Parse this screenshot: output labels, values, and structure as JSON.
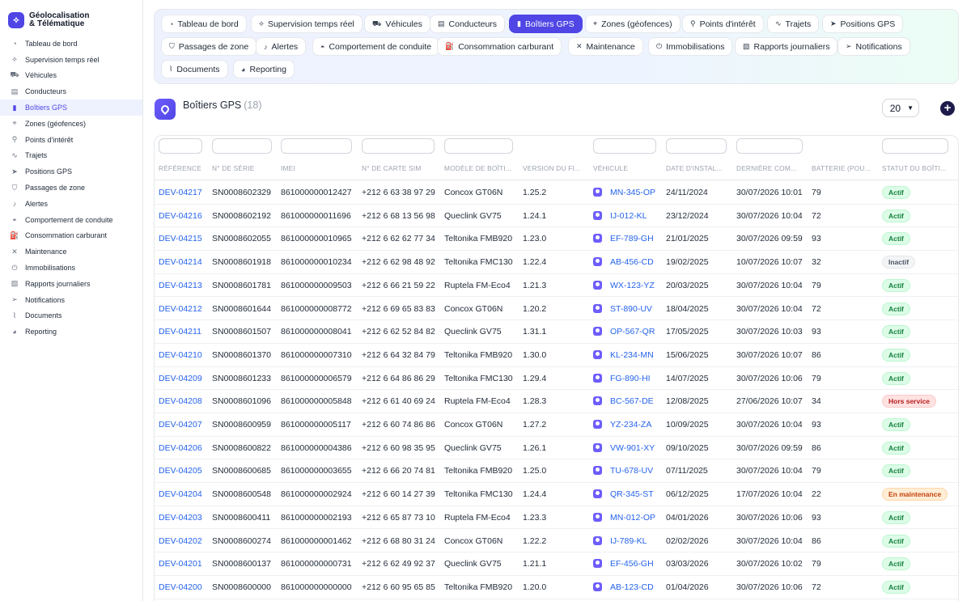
{
  "app": {
    "title_line1": "Géolocalisation",
    "title_line2": "& Télématique"
  },
  "sidebar": {
    "items": [
      {
        "label": "Tableau de bord",
        "icon": "dashboard-icon",
        "glyph": "◔"
      },
      {
        "label": "Supervision temps réel",
        "icon": "satellite-icon",
        "glyph": "⟡"
      },
      {
        "label": "Véhicules",
        "icon": "car-icon",
        "glyph": "⛟"
      },
      {
        "label": "Conducteurs",
        "icon": "id-card-icon",
        "glyph": "▤"
      },
      {
        "label": "Boîtiers GPS",
        "icon": "device-icon",
        "glyph": "▮"
      },
      {
        "label": "Zones (géofences)",
        "icon": "map-icon",
        "glyph": "⌖"
      },
      {
        "label": "Points d'intérêt",
        "icon": "map-pin-icon",
        "glyph": "⚲"
      },
      {
        "label": "Trajets",
        "icon": "route-icon",
        "glyph": "∿"
      },
      {
        "label": "Positions GPS",
        "icon": "navigation-icon",
        "glyph": "➤"
      },
      {
        "label": "Passages de zone",
        "icon": "shield-icon",
        "glyph": "⛉"
      },
      {
        "label": "Alertes",
        "icon": "bell-icon",
        "glyph": "♪"
      },
      {
        "label": "Comportement de conduite",
        "icon": "gauge-icon",
        "glyph": "◓"
      },
      {
        "label": "Consommation carburant",
        "icon": "fuel-icon",
        "glyph": "⛽"
      },
      {
        "label": "Maintenance",
        "icon": "wrench-icon",
        "glyph": "✕"
      },
      {
        "label": "Immobilisations",
        "icon": "power-icon",
        "glyph": "⏻"
      },
      {
        "label": "Rapports journaliers",
        "icon": "file-icon",
        "glyph": "▧"
      },
      {
        "label": "Notifications",
        "icon": "send-icon",
        "glyph": "➢"
      },
      {
        "label": "Documents",
        "icon": "paperclip-icon",
        "glyph": "⌇"
      },
      {
        "label": "Reporting",
        "icon": "pie-chart-icon",
        "glyph": "◕"
      }
    ],
    "active_index": 4
  },
  "tabs": {
    "items": [
      {
        "label": "Tableau de bord",
        "glyph": "◔"
      },
      {
        "label": "Supervision temps réel",
        "glyph": "⟡"
      },
      {
        "label": "Véhicules",
        "glyph": "⛟"
      },
      {
        "label": "Conducteurs",
        "glyph": "▤"
      },
      {
        "label": "Boîtiers GPS",
        "glyph": "▮"
      },
      {
        "label": "Zones (géofences)",
        "glyph": "⌖"
      },
      {
        "label": "Points d'intérêt",
        "glyph": "⚲"
      },
      {
        "label": "Trajets",
        "glyph": "∿"
      },
      {
        "label": "Positions GPS",
        "glyph": "➤"
      },
      {
        "label": "Passages de zone",
        "glyph": "⛉"
      },
      {
        "label": "Alertes",
        "glyph": "♪"
      },
      {
        "label": "Comportement de conduite",
        "glyph": "◓"
      },
      {
        "label": "Consommation carburant",
        "glyph": "⛽"
      },
      {
        "label": "Maintenance",
        "glyph": "✕"
      },
      {
        "label": "Immobilisations",
        "glyph": "⏻"
      },
      {
        "label": "Rapports journaliers",
        "glyph": "▧"
      },
      {
        "label": "Notifications",
        "glyph": "➢"
      },
      {
        "label": "Documents",
        "glyph": "⌇"
      },
      {
        "label": "Reporting",
        "glyph": "◕"
      }
    ],
    "active_index": 4
  },
  "header": {
    "title": "Boîtiers GPS",
    "count": "(18)",
    "per_page": "20",
    "add_label": "+"
  },
  "table": {
    "columns": [
      "RÉFÉRENCE",
      "N° DE SÉRIE",
      "IMEI",
      "N° DE CARTE SIM",
      "MODÈLE DE BOÎTI...",
      "VERSION DU FI...",
      "VÉHICULE",
      "DATE D'INSTAL...",
      "DERNIÈRE COM...",
      "BATTERIE (POU...",
      "STATUT DU BOÎTI..."
    ],
    "rows": [
      {
        "ref": "DEV-04217",
        "serial": "SN0008602329",
        "imei": "861000000012427",
        "sim": "+212 6 63 38 97 29",
        "model": "Concox GT06N",
        "fw": "1.25.2",
        "vehicle": "MN-345-OP",
        "install": "24/11/2024",
        "last": "30/07/2026 10:01",
        "battery": "79",
        "status": "Actif",
        "status_kind": "actif"
      },
      {
        "ref": "DEV-04216",
        "serial": "SN0008602192",
        "imei": "861000000011696",
        "sim": "+212 6 68 13 56 98",
        "model": "Queclink GV75",
        "fw": "1.24.1",
        "vehicle": "IJ-012-KL",
        "install": "23/12/2024",
        "last": "30/07/2026 10:04",
        "battery": "72",
        "status": "Actif",
        "status_kind": "actif"
      },
      {
        "ref": "DEV-04215",
        "serial": "SN0008602055",
        "imei": "861000000010965",
        "sim": "+212 6 62 62 77 34",
        "model": "Teltonika FMB920",
        "fw": "1.23.0",
        "vehicle": "EF-789-GH",
        "install": "21/01/2025",
        "last": "30/07/2026 09:59",
        "battery": "93",
        "status": "Actif",
        "status_kind": "actif"
      },
      {
        "ref": "DEV-04214",
        "serial": "SN0008601918",
        "imei": "861000000010234",
        "sim": "+212 6 62 98 48 92",
        "model": "Teltonika FMC130",
        "fw": "1.22.4",
        "vehicle": "AB-456-CD",
        "install": "19/02/2025",
        "last": "10/07/2026 10:07",
        "battery": "32",
        "status": "Inactif",
        "status_kind": "inactif"
      },
      {
        "ref": "DEV-04213",
        "serial": "SN0008601781",
        "imei": "861000000009503",
        "sim": "+212 6 66 21 59 22",
        "model": "Ruptela FM-Eco4",
        "fw": "1.21.3",
        "vehicle": "WX-123-YZ",
        "install": "20/03/2025",
        "last": "30/07/2026 10:04",
        "battery": "79",
        "status": "Actif",
        "status_kind": "actif"
      },
      {
        "ref": "DEV-04212",
        "serial": "SN0008601644",
        "imei": "861000000008772",
        "sim": "+212 6 69 65 83 83",
        "model": "Concox GT06N",
        "fw": "1.20.2",
        "vehicle": "ST-890-UV",
        "install": "18/04/2025",
        "last": "30/07/2026 10:04",
        "battery": "72",
        "status": "Actif",
        "status_kind": "actif"
      },
      {
        "ref": "DEV-04211",
        "serial": "SN0008601507",
        "imei": "861000000008041",
        "sim": "+212 6 62 52 84 82",
        "model": "Queclink GV75",
        "fw": "1.31.1",
        "vehicle": "OP-567-QR",
        "install": "17/05/2025",
        "last": "30/07/2026 10:03",
        "battery": "93",
        "status": "Actif",
        "status_kind": "actif"
      },
      {
        "ref": "DEV-04210",
        "serial": "SN0008601370",
        "imei": "861000000007310",
        "sim": "+212 6 64 32 84 79",
        "model": "Teltonika FMB920",
        "fw": "1.30.0",
        "vehicle": "KL-234-MN",
        "install": "15/06/2025",
        "last": "30/07/2026 10:07",
        "battery": "86",
        "status": "Actif",
        "status_kind": "actif"
      },
      {
        "ref": "DEV-04209",
        "serial": "SN0008601233",
        "imei": "861000000006579",
        "sim": "+212 6 64 86 86 29",
        "model": "Teltonika FMC130",
        "fw": "1.29.4",
        "vehicle": "FG-890-HI",
        "install": "14/07/2025",
        "last": "30/07/2026 10:06",
        "battery": "79",
        "status": "Actif",
        "status_kind": "actif"
      },
      {
        "ref": "DEV-04208",
        "serial": "SN0008601096",
        "imei": "861000000005848",
        "sim": "+212 6 61 40 69 24",
        "model": "Ruptela FM-Eco4",
        "fw": "1.28.3",
        "vehicle": "BC-567-DE",
        "install": "12/08/2025",
        "last": "27/06/2026 10:07",
        "battery": "34",
        "status": "Hors service",
        "status_kind": "hors"
      },
      {
        "ref": "DEV-04207",
        "serial": "SN0008600959",
        "imei": "861000000005117",
        "sim": "+212 6 60 74 86 86",
        "model": "Concox GT06N",
        "fw": "1.27.2",
        "vehicle": "YZ-234-ZA",
        "install": "10/09/2025",
        "last": "30/07/2026 10:04",
        "battery": "93",
        "status": "Actif",
        "status_kind": "actif"
      },
      {
        "ref": "DEV-04206",
        "serial": "SN0008600822",
        "imei": "861000000004386",
        "sim": "+212 6 60 98 35 95",
        "model": "Queclink GV75",
        "fw": "1.26.1",
        "vehicle": "VW-901-XY",
        "install": "09/10/2025",
        "last": "30/07/2026 09:59",
        "battery": "86",
        "status": "Actif",
        "status_kind": "actif"
      },
      {
        "ref": "DEV-04205",
        "serial": "SN0008600685",
        "imei": "861000000003655",
        "sim": "+212 6 66 20 74 81",
        "model": "Teltonika FMB920",
        "fw": "1.25.0",
        "vehicle": "TU-678-UV",
        "install": "07/11/2025",
        "last": "30/07/2026 10:04",
        "battery": "79",
        "status": "Actif",
        "status_kind": "actif"
      },
      {
        "ref": "DEV-04204",
        "serial": "SN0008600548",
        "imei": "861000000002924",
        "sim": "+212 6 60 14 27 39",
        "model": "Teltonika FMC130",
        "fw": "1.24.4",
        "vehicle": "QR-345-ST",
        "install": "06/12/2025",
        "last": "17/07/2026 10:04",
        "battery": "22",
        "status": "En maintenance",
        "status_kind": "maint"
      },
      {
        "ref": "DEV-04203",
        "serial": "SN0008600411",
        "imei": "861000000002193",
        "sim": "+212 6 65 87 73 10",
        "model": "Ruptela FM-Eco4",
        "fw": "1.23.3",
        "vehicle": "MN-012-OP",
        "install": "04/01/2026",
        "last": "30/07/2026 10:06",
        "battery": "93",
        "status": "Actif",
        "status_kind": "actif"
      },
      {
        "ref": "DEV-04202",
        "serial": "SN0008600274",
        "imei": "861000000001462",
        "sim": "+212 6 68 80 31 24",
        "model": "Concox GT06N",
        "fw": "1.22.2",
        "vehicle": "IJ-789-KL",
        "install": "02/02/2026",
        "last": "30/07/2026 10:04",
        "battery": "86",
        "status": "Actif",
        "status_kind": "actif"
      },
      {
        "ref": "DEV-04201",
        "serial": "SN0008600137",
        "imei": "861000000000731",
        "sim": "+212 6 62 49 92 37",
        "model": "Queclink GV75",
        "fw": "1.21.1",
        "vehicle": "EF-456-GH",
        "install": "03/03/2026",
        "last": "30/07/2026 10:02",
        "battery": "79",
        "status": "Actif",
        "status_kind": "actif"
      },
      {
        "ref": "DEV-04200",
        "serial": "SN0008600000",
        "imei": "861000000000000",
        "sim": "+212 6 60 95 65 85",
        "model": "Teltonika FMB920",
        "fw": "1.20.0",
        "vehicle": "AB-123-CD",
        "install": "01/04/2026",
        "last": "30/07/2026 10:06",
        "battery": "72",
        "status": "Actif",
        "status_kind": "actif"
      }
    ]
  },
  "colors": {
    "accent": "#4f46e5",
    "link": "#2563eb",
    "active_green": "#15803d"
  }
}
